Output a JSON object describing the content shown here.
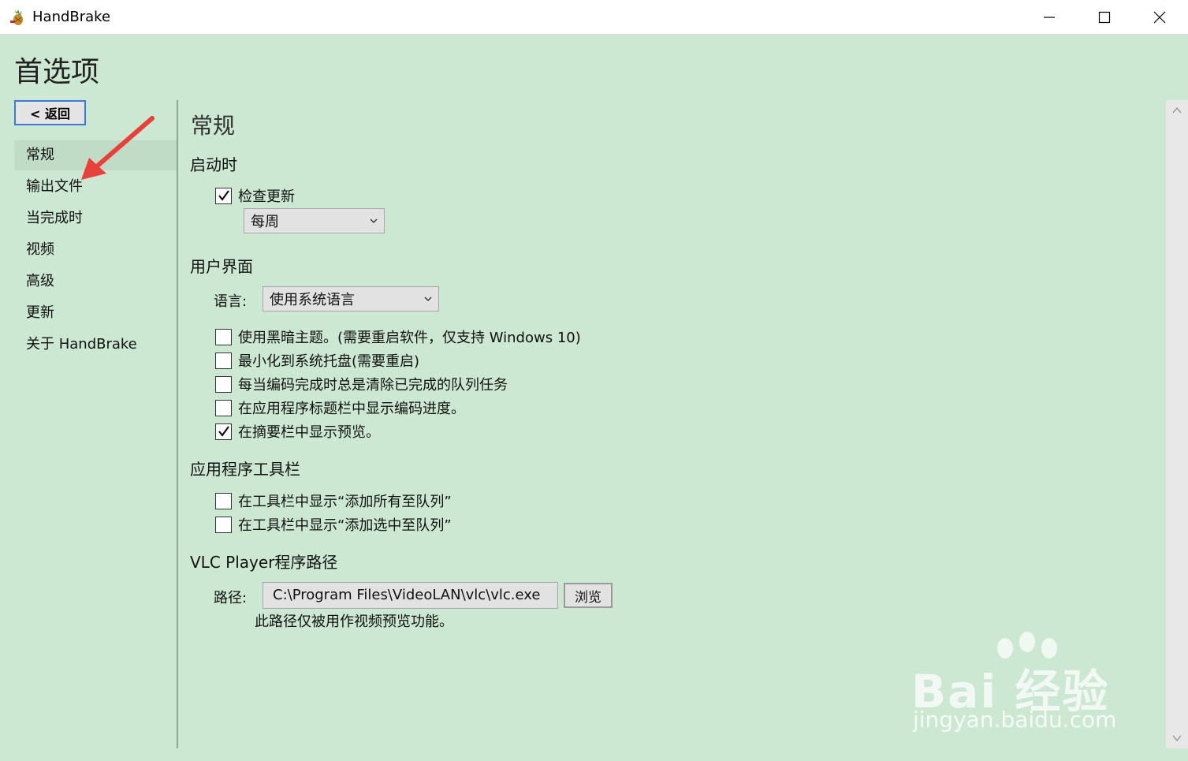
{
  "window": {
    "title": "HandBrake",
    "icon": "handbrake-pineapple-icon"
  },
  "page": {
    "title": "首选项"
  },
  "back_button": {
    "label": "< 返回"
  },
  "sidebar": {
    "items": [
      {
        "label": "常规",
        "selected": true
      },
      {
        "label": "输出文件",
        "selected": false
      },
      {
        "label": "当完成时",
        "selected": false
      },
      {
        "label": "视频",
        "selected": false
      },
      {
        "label": "高级",
        "selected": false
      },
      {
        "label": "更新",
        "selected": false
      },
      {
        "label": "关于 HandBrake",
        "selected": false
      }
    ]
  },
  "content": {
    "section_title": "常规",
    "startup": {
      "title": "启动时",
      "check_updates": {
        "label": "检查更新",
        "checked": true
      },
      "update_frequency": {
        "value": "每周"
      }
    },
    "ui": {
      "title": "用户界面",
      "language_label": "语言:",
      "language_value": "使用系统语言",
      "options": [
        {
          "label": "使用黑暗主题。(需要重启软件，仅支持 Windows 10)",
          "checked": false
        },
        {
          "label": "最小化到系统托盘(需要重启)",
          "checked": false
        },
        {
          "label": "每当编码完成时总是清除已完成的队列任务",
          "checked": false
        },
        {
          "label": "在应用程序标题栏中显示编码进度。",
          "checked": false
        },
        {
          "label": "在摘要栏中显示预览。",
          "checked": true
        }
      ]
    },
    "toolbar": {
      "title": "应用程序工具栏",
      "options": [
        {
          "label": "在工具栏中显示“添加所有至队列”",
          "checked": false
        },
        {
          "label": "在工具栏中显示“添加选中至队列”",
          "checked": false
        }
      ]
    },
    "vlc": {
      "title": "VLC Player程序路径",
      "path_label": "路径:",
      "path_value": "C:\\Program Files\\VideoLAN\\vlc\\vlc.exe",
      "browse_label": "浏览",
      "note": "此路径仅被用作视频预览功能。"
    }
  },
  "watermark": {
    "brand": "Bai 经验",
    "url": "jingyan.baidu.com"
  },
  "colors": {
    "background": "#cce8d2",
    "selected": "#c1dcc6",
    "annotation_arrow": "#e8413c",
    "focus_border": "#3c7ad6"
  }
}
